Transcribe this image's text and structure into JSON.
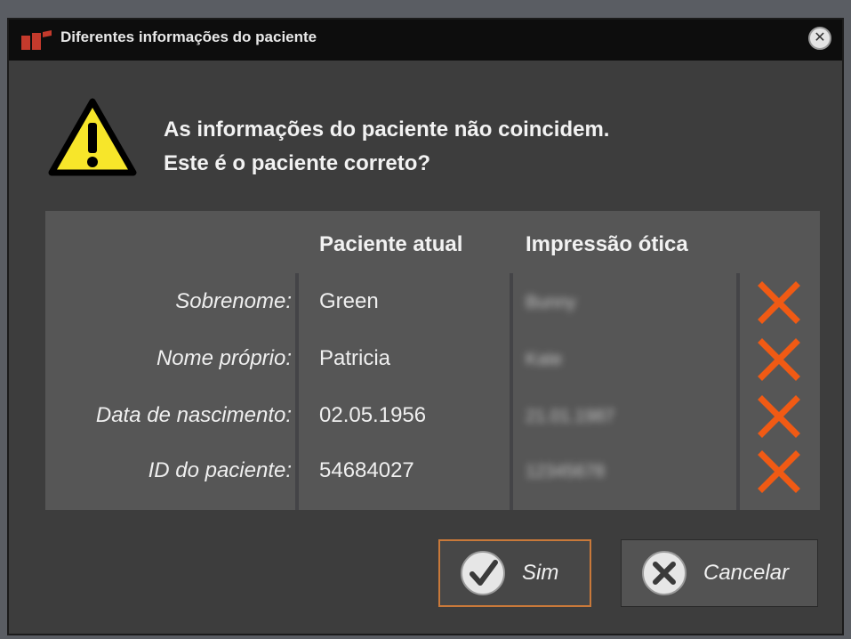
{
  "window": {
    "title": "Diferentes informações do paciente"
  },
  "message": {
    "line1": "As informações do paciente não coincidem.",
    "line2": "Este é o paciente correto?"
  },
  "table": {
    "col_current": "Paciente atual",
    "col_scan": "Impressão ótica",
    "rows": [
      {
        "label": "Sobrenome:",
        "current": "Green",
        "scan": "Bunny"
      },
      {
        "label": "Nome próprio:",
        "current": "Patricia",
        "scan": "Kate"
      },
      {
        "label": "Data de nascimento:",
        "current": "02.05.1956",
        "scan": "21.01.1987"
      },
      {
        "label": "ID do paciente:",
        "current": "54684027",
        "scan": "12345678"
      }
    ]
  },
  "buttons": {
    "yes_label": "Sim",
    "cancel_label": "Cancelar"
  },
  "colors": {
    "mismatch": "#f05a14",
    "accent_border": "#c9793a",
    "warning": "#f7e62a"
  },
  "icons": {
    "logo": "app-logo-icon",
    "close": "close-icon",
    "warning": "warning-icon",
    "mismatch": "mismatch-x-icon",
    "yes": "check-circle-icon",
    "cancel": "x-circle-icon"
  }
}
